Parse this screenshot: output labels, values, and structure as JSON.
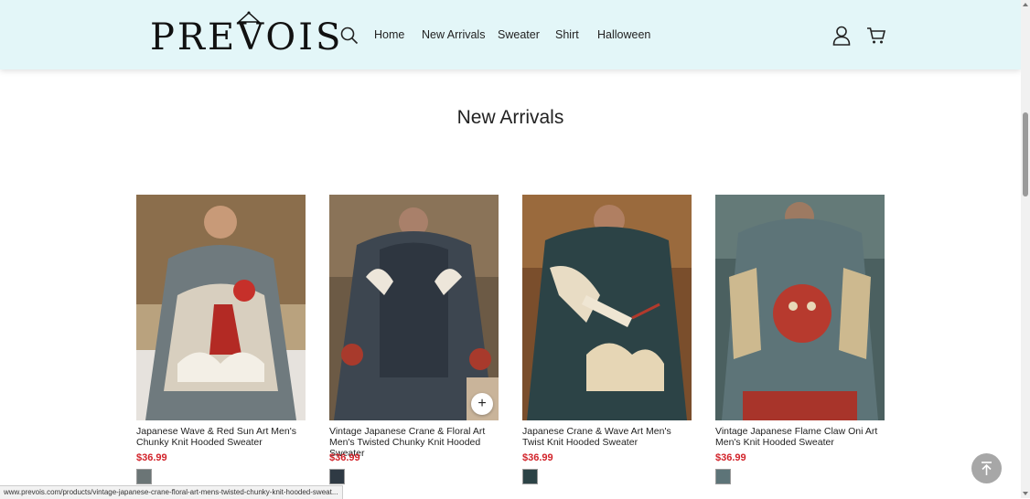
{
  "header": {
    "logo_text": "PREVOIS",
    "nav": [
      "Home",
      "New Arrivals",
      "Sweater",
      "Shirt",
      "Halloween"
    ],
    "icons": [
      "search-icon",
      "account-icon",
      "cart-icon"
    ]
  },
  "section": {
    "title": "New Arrivals"
  },
  "products": [
    {
      "name": "Japanese Wave & Red Sun Art Men's Chunky Knit Hooded Sweater",
      "price": "$36.99"
    },
    {
      "name": "Vintage Japanese Crane & Floral Art Men's Twisted Chunky Knit Hooded Sweater",
      "price": "$36.99"
    },
    {
      "name": "Japanese Crane & Wave Art Men's Twist Knit Hooded Sweater",
      "price": "$36.99"
    },
    {
      "name": "Vintage Japanese Flame Claw Oni Art Men's Knit Hooded Sweater",
      "price": "$36.99"
    }
  ],
  "status_url": "www.prevois.com/products/vintage-japanese-crane-floral-art-mens-twisted-chunky-knit-hooded-sweat...",
  "colors": {
    "header_bg": "#e3f6f8",
    "price": "#d2232a",
    "back_to_top": "#a7a7a7"
  }
}
